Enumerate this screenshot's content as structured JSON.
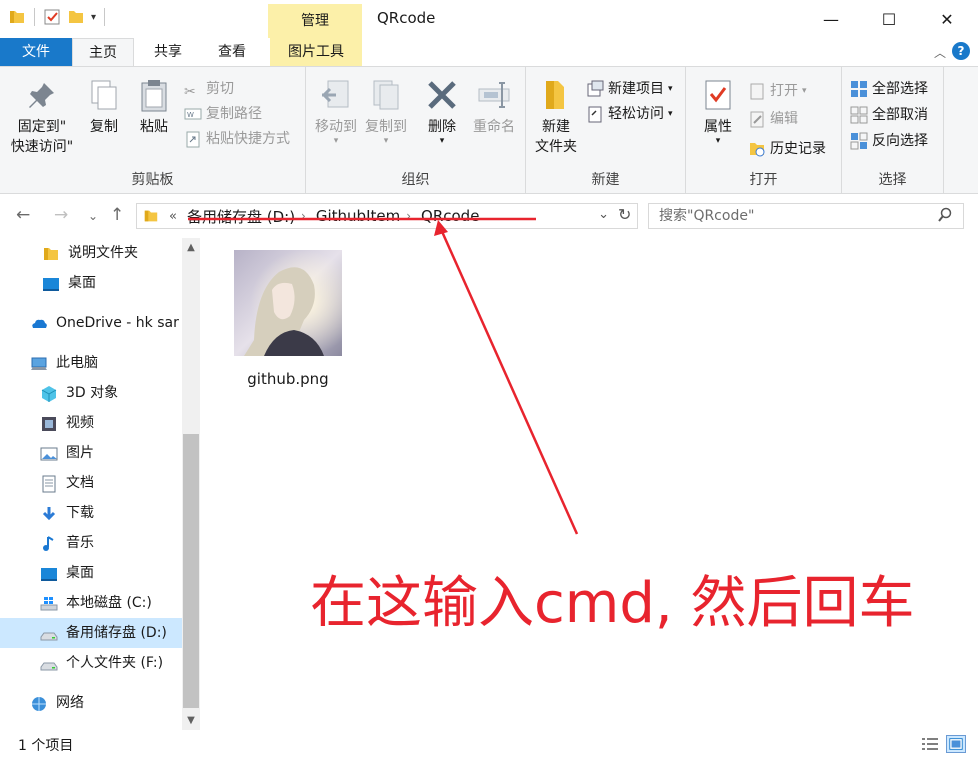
{
  "window": {
    "title": "QRcode",
    "context_tab": "管理",
    "controls": {
      "minimize": "—",
      "maximize": "☐",
      "close": "✕"
    }
  },
  "tabs": {
    "file": "文件",
    "home": "主页",
    "share": "共享",
    "view": "查看",
    "picture_tools": "图片工具"
  },
  "ribbon": {
    "clipboard": {
      "label": "剪贴板",
      "pin_line1": "固定到\"",
      "pin_line2": "快速访问\"",
      "copy": "复制",
      "paste": "粘贴",
      "cut": "剪切",
      "copy_path": "复制路径",
      "paste_shortcut": "粘贴快捷方式"
    },
    "organize": {
      "label": "组织",
      "move_to": "移动到",
      "copy_to": "复制到",
      "delete": "删除",
      "rename": "重命名"
    },
    "new": {
      "label": "新建",
      "new_folder_line1": "新建",
      "new_folder_line2": "文件夹",
      "new_item": "新建项目",
      "easy_access": "轻松访问"
    },
    "open": {
      "label": "打开",
      "properties": "属性",
      "open": "打开",
      "edit": "编辑",
      "history": "历史记录"
    },
    "select": {
      "label": "选择",
      "select_all": "全部选择",
      "select_none": "全部取消",
      "invert": "反向选择"
    }
  },
  "address": {
    "overflow": "«",
    "crumbs": [
      "备用储存盘 (D:)",
      "GithubItem",
      "QRcode"
    ],
    "search_placeholder": "搜索\"QRcode\""
  },
  "sidebar": {
    "items": [
      {
        "label": "说明文件夹",
        "icon": "folder-icon"
      },
      {
        "label": "桌面",
        "icon": "desktop-icon"
      },
      {
        "label": "OneDrive - hk sar",
        "icon": "onedrive-icon"
      },
      {
        "label": "此电脑",
        "icon": "pc-icon"
      },
      {
        "label": "3D 对象",
        "icon": "3d-objects-icon"
      },
      {
        "label": "视频",
        "icon": "video-icon"
      },
      {
        "label": "图片",
        "icon": "pictures-icon"
      },
      {
        "label": "文档",
        "icon": "documents-icon"
      },
      {
        "label": "下载",
        "icon": "download-icon"
      },
      {
        "label": "音乐",
        "icon": "music-icon"
      },
      {
        "label": "桌面",
        "icon": "desktop-icon"
      },
      {
        "label": "本地磁盘 (C:)",
        "icon": "windows-drive-icon"
      },
      {
        "label": "备用储存盘 (D:)",
        "icon": "drive-icon"
      },
      {
        "label": "个人文件夹 (F:)",
        "icon": "drive-icon"
      },
      {
        "label": "网络",
        "icon": "network-icon"
      }
    ],
    "selected_index": 12
  },
  "content": {
    "files": [
      {
        "name": "github.png"
      }
    ]
  },
  "status": {
    "count": "1 个项目"
  },
  "annotation": {
    "text": "在这输入cmd, 然后回车",
    "color": "#e8242e"
  },
  "colors": {
    "accent": "#1979ca",
    "context_tab": "#fcf0a9",
    "selection": "#cce8ff"
  }
}
